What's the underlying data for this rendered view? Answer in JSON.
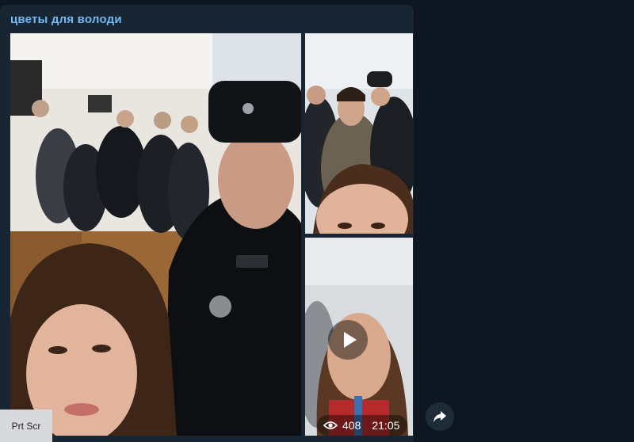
{
  "channel": {
    "name": "цветы для володи"
  },
  "album": {
    "photos": [
      {
        "name": "selfie-with-police-officer"
      },
      {
        "name": "selfie-in-crowd"
      }
    ],
    "video": {
      "views": "408",
      "time": "21:05"
    }
  },
  "icons": {
    "eye": "eye-icon",
    "play": "play-icon",
    "share": "share-icon"
  },
  "overlay": {
    "prtscr_label": "Prt Scr"
  },
  "colors": {
    "background": "#0e1621",
    "bubble": "#182533",
    "channel_name": "#71baf4"
  }
}
